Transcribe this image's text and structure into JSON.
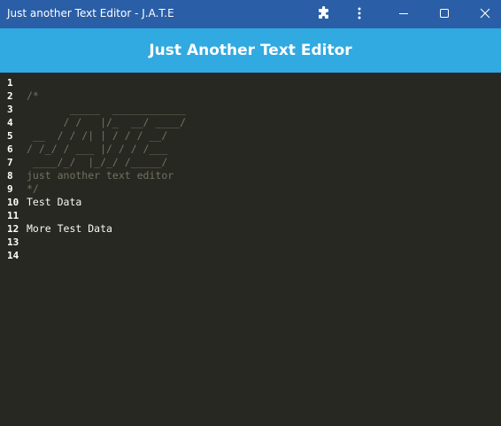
{
  "window": {
    "title": "Just another Text Editor - J.A.T.E",
    "icons": [
      "puzzle-extension-icon",
      "kebab-menu-icon",
      "minimize-icon",
      "maximize-icon",
      "close-icon"
    ]
  },
  "header": {
    "title": "Just Another Text Editor"
  },
  "editor": {
    "line_numbers": [
      "1",
      "2",
      "3",
      "4",
      "5",
      "6",
      "7",
      "8",
      "9",
      "10",
      "11",
      "12",
      "13",
      "14"
    ],
    "lines": [
      {
        "text": "",
        "style": "plain"
      },
      {
        "text": "/*",
        "style": "comment"
      },
      {
        "text": "       _____  ____________",
        "style": "comment"
      },
      {
        "text": "      / /   |/_  __/ ____/",
        "style": "comment"
      },
      {
        "text": " __  / / /| | / / / __/",
        "style": "comment"
      },
      {
        "text": "/ /_/ / ___ |/ / / /___",
        "style": "comment"
      },
      {
        "text": " ____/_/  |_/_/ /_____/",
        "style": "comment"
      },
      {
        "text": "just another text editor",
        "style": "comment"
      },
      {
        "text": "*/",
        "style": "comment"
      },
      {
        "text": "Test Data",
        "style": "plain"
      },
      {
        "text": "",
        "style": "plain"
      },
      {
        "text": "More Test Data",
        "style": "plain"
      },
      {
        "text": "",
        "style": "plain"
      },
      {
        "text": "",
        "style": "plain"
      }
    ]
  },
  "colors": {
    "titlebar": "#2a5ea6",
    "header": "#31a9e1",
    "editor_bg": "#272822",
    "comment": "#75715e",
    "text": "#f8f8f2"
  }
}
